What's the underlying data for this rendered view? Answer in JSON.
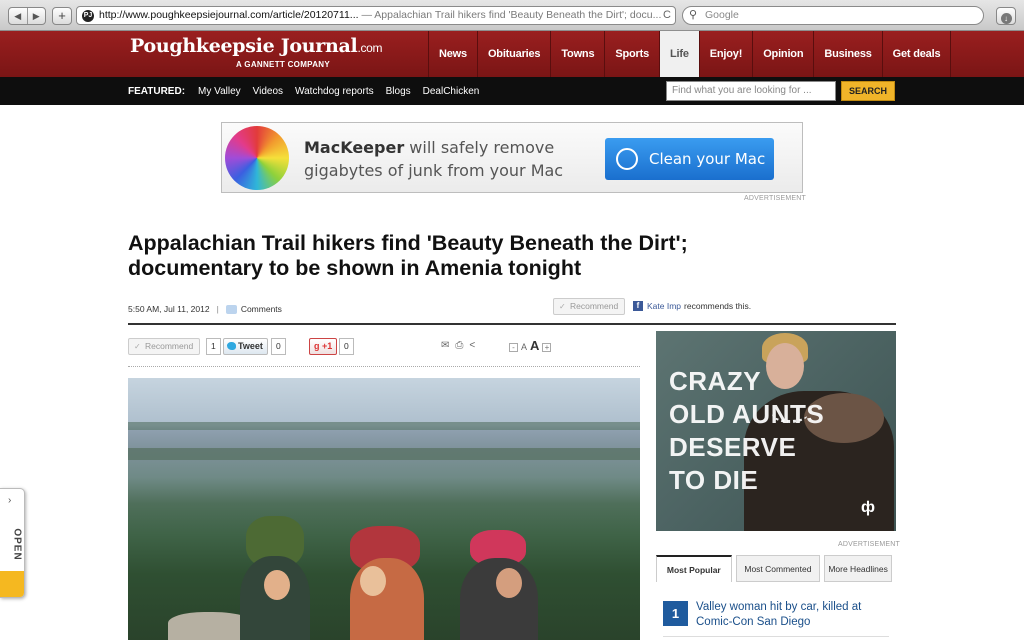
{
  "browser": {
    "url": "http://www.poughkeepsiejournal.com/article/20120711...",
    "page_title": "— Appalachian Trail hikers find 'Beauty Beneath the Dirt'; docu...",
    "search_placeholder": "Google",
    "back_glyph": "◀",
    "forward_glyph": "▶",
    "add_glyph": "+",
    "reload_glyph": "C"
  },
  "site": {
    "logo_name": "Poughkeepsie Journal",
    "logo_suffix": ".com",
    "logo_sub": "A GANNETT COMPANY",
    "brand_color": "#8b1a1a"
  },
  "nav": {
    "items": [
      "News",
      "Obituaries",
      "Towns",
      "Sports",
      "Life",
      "Enjoy!",
      "Opinion",
      "Business",
      "Get deals"
    ],
    "active": "Life"
  },
  "featured": {
    "label": "FEATURED:",
    "links": [
      "My Valley",
      "Videos",
      "Watchdog reports",
      "Blogs",
      "DealChicken"
    ],
    "search_placeholder": "Find what you are looking for ...",
    "search_button": "SEARCH"
  },
  "ad_banner": {
    "brand": "MacKeeper",
    "line1_rest": " will safely remove",
    "line2": "gigabytes of junk from your Mac",
    "cta": "Clean your Mac",
    "note": "ADVERTISEMENT"
  },
  "article": {
    "headline": "Appalachian Trail hikers find 'Beauty Beneath the Dirt'; documentary to be shown in Amenia tonight",
    "timestamp": "5:50 AM, Jul 11, 2012",
    "separator": "|",
    "comments_label": "Comments",
    "recommend_label": "Recommend",
    "fb_name": "Kate Imp",
    "fb_text": "recommends this.",
    "share": {
      "recommend_label": "Recommend",
      "recommend_count": "1",
      "tweet_label": "Tweet",
      "tweet_count": "0",
      "gplus_label": "+1",
      "gplus_count": "0",
      "font_small": "A",
      "font_large": "A",
      "font_minus": "-",
      "font_plus": "+"
    }
  },
  "side_ad": {
    "lines": [
      "CRAZY",
      "OLD AUNTS",
      "DESERVE",
      "TO DIE"
    ],
    "note": "ADVERTISEMENT"
  },
  "widget": {
    "tabs": [
      "Most Popular",
      "Most Commented",
      "More Headlines"
    ],
    "active_tab": "Most Popular",
    "items": [
      {
        "rank": "1",
        "title": "Valley woman hit by car, killed at Comic-Con San Diego"
      }
    ]
  },
  "open_tab": {
    "label": "OPEN",
    "arrow": "›"
  },
  "icons": [
    "back-icon",
    "forward-icon",
    "add-icon",
    "reload-icon",
    "search-icon",
    "download-icon",
    "comment-icon",
    "facebook-icon",
    "twitter-icon",
    "email-icon",
    "print-icon",
    "share-icon"
  ]
}
